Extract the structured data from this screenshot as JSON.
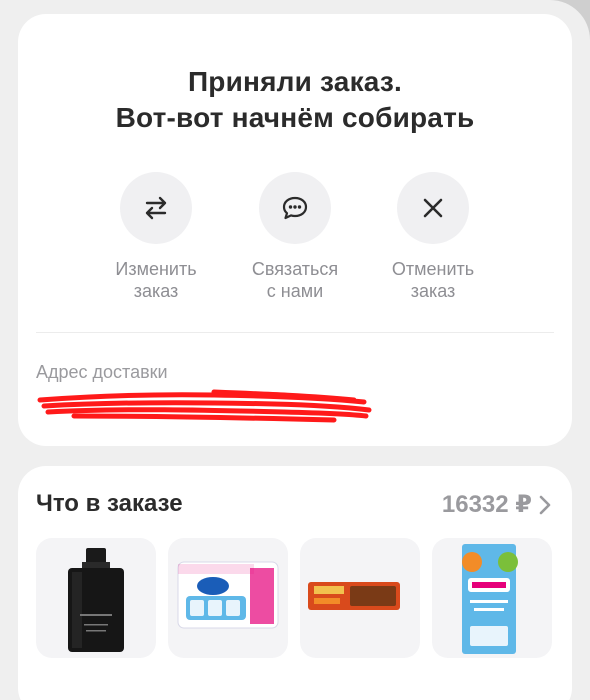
{
  "status": {
    "title_line1": "Приняли заказ.",
    "title_line2": "Вот-вот начнём собирать"
  },
  "actions": [
    {
      "label": "Изменить\nзаказ",
      "icon": "swap-arrows-icon"
    },
    {
      "label": "Связаться\nс нами",
      "icon": "chat-bubble-icon"
    },
    {
      "label": "Отменить\nзаказ",
      "icon": "close-icon"
    }
  ],
  "delivery": {
    "label": "Адрес доставки",
    "value_redacted": true
  },
  "order": {
    "title": "Что в заказе",
    "total": "16332 ₽",
    "items": [
      {
        "name": "perfume-bottle",
        "icon": "perfume-image"
      },
      {
        "name": "zewa-toilet-paper",
        "icon": "toilet-paper-image"
      },
      {
        "name": "chocolate-bar",
        "icon": "snack-bar-image"
      },
      {
        "name": "fruto-nyanya-juice",
        "icon": "juice-box-image"
      }
    ]
  },
  "colors": {
    "background": "#efefef",
    "card": "#ffffff",
    "text_primary": "#2b2b2b",
    "text_secondary": "#9a9a9e",
    "icon_circle": "#f0f0f2",
    "scribble": "#ff1a1a"
  }
}
